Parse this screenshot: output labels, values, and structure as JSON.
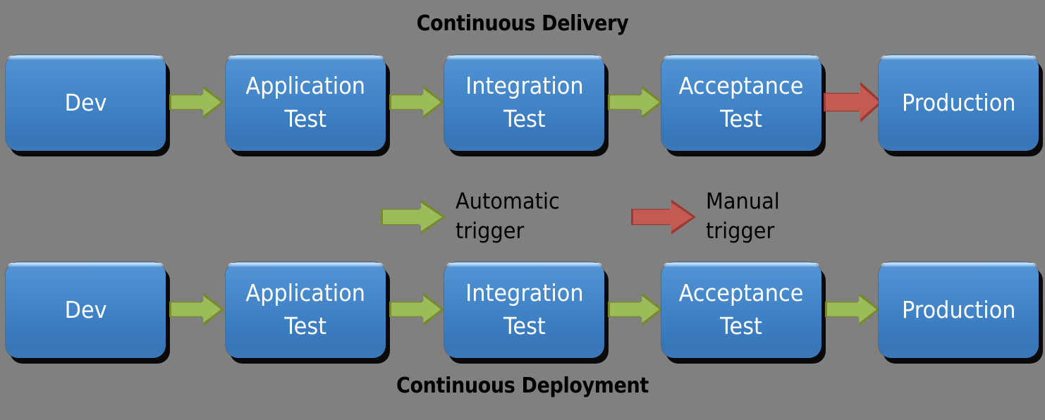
{
  "background_color": "#808080",
  "colors": {
    "box_fill": "#3f81c6",
    "box_text": "#ffffff",
    "automatic_arrow": "#9cbc59",
    "automatic_arrow_border": "#77892f",
    "manual_arrow": "#c35b53",
    "manual_arrow_border": "#9b3a32",
    "title_text": "#000000"
  },
  "diagram": {
    "rows": [
      {
        "id": "continuous-delivery",
        "title": "Continuous Delivery",
        "title_position": "top",
        "stages": [
          {
            "label": "Dev"
          },
          {
            "label": "Application\nTest"
          },
          {
            "label": "Integration\nTest"
          },
          {
            "label": "Acceptance\nTest"
          },
          {
            "label": "Production"
          }
        ],
        "connectors": [
          {
            "type": "automatic",
            "color": "#9cbc59"
          },
          {
            "type": "automatic",
            "color": "#9cbc59"
          },
          {
            "type": "automatic",
            "color": "#9cbc59"
          },
          {
            "type": "manual",
            "color": "#c35b53"
          }
        ]
      },
      {
        "id": "continuous-deployment",
        "title": "Continuous Deployment",
        "title_position": "bottom",
        "stages": [
          {
            "label": "Dev"
          },
          {
            "label": "Application\nTest"
          },
          {
            "label": "Integration\nTest"
          },
          {
            "label": "Acceptance\nTest"
          },
          {
            "label": "Production"
          }
        ],
        "connectors": [
          {
            "type": "automatic",
            "color": "#9cbc59"
          },
          {
            "type": "automatic",
            "color": "#9cbc59"
          },
          {
            "type": "automatic",
            "color": "#9cbc59"
          },
          {
            "type": "automatic",
            "color": "#9cbc59"
          }
        ]
      }
    ]
  },
  "legend": {
    "items": [
      {
        "icon": "green-right-arrow-icon",
        "label": "Automatic\ntrigger",
        "color": "#9cbc59"
      },
      {
        "icon": "red-right-arrow-icon",
        "label": "Manual\ntrigger",
        "color": "#c35b53"
      }
    ]
  }
}
